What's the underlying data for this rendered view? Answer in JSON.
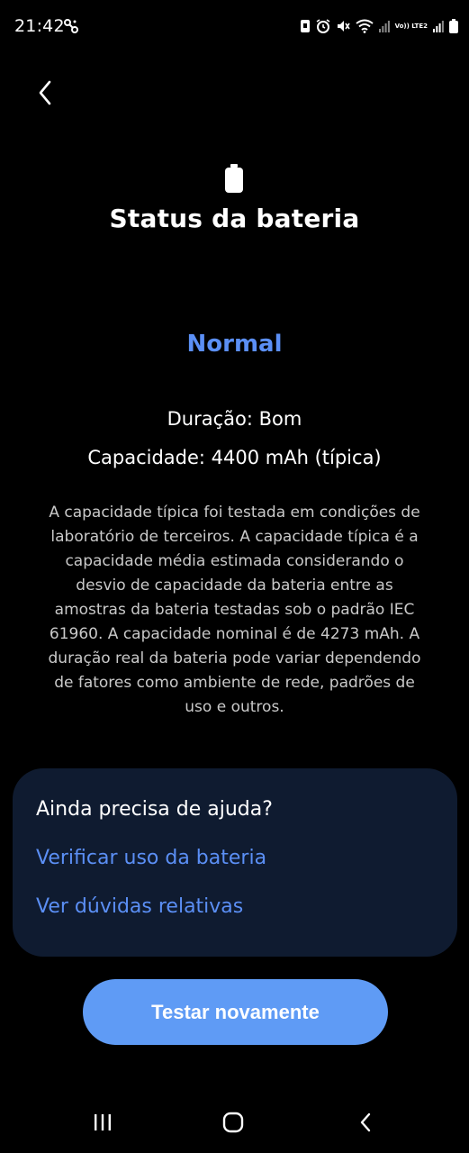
{
  "status_bar": {
    "time": "21:42",
    "network_label": "Vo)) LTE2",
    "icons": [
      "link-icon",
      "nfc-icon",
      "alarm-icon",
      "mute-icon",
      "wifi-icon",
      "signal-icon",
      "battery-icon"
    ]
  },
  "header": {
    "back_icon": "chevron-left-icon",
    "battery_icon": "battery-icon",
    "title": "Status da bateria"
  },
  "status": {
    "value": "Normal",
    "duration": "Duração: Bom",
    "capacity": "Capacidade: 4400 mAh (típica)",
    "description": "A capacidade típica foi testada em condições de laboratório de terceiros. A capacidade típica é a capacidade média estimada considerando o desvio de capacidade da bateria entre as amostras da bateria testadas sob o padrão IEC 61960. A capacidade nominal é de 4273 mAh. A duração real da bateria pode variar dependendo de fatores como ambiente de rede, padrões de uso e outros."
  },
  "help": {
    "title": "Ainda precisa de ajuda?",
    "links": [
      "Verificar uso da bateria",
      "Ver dúvidas relativas"
    ]
  },
  "actions": {
    "test_again": "Testar novamente"
  },
  "nav_bar": {
    "icons": [
      "recent-apps-icon",
      "home-icon",
      "back-icon"
    ]
  },
  "colors": {
    "background": "#000000",
    "accent": "#5b8ff5",
    "card": "#0f1b30",
    "button": "#5f9bf5"
  }
}
